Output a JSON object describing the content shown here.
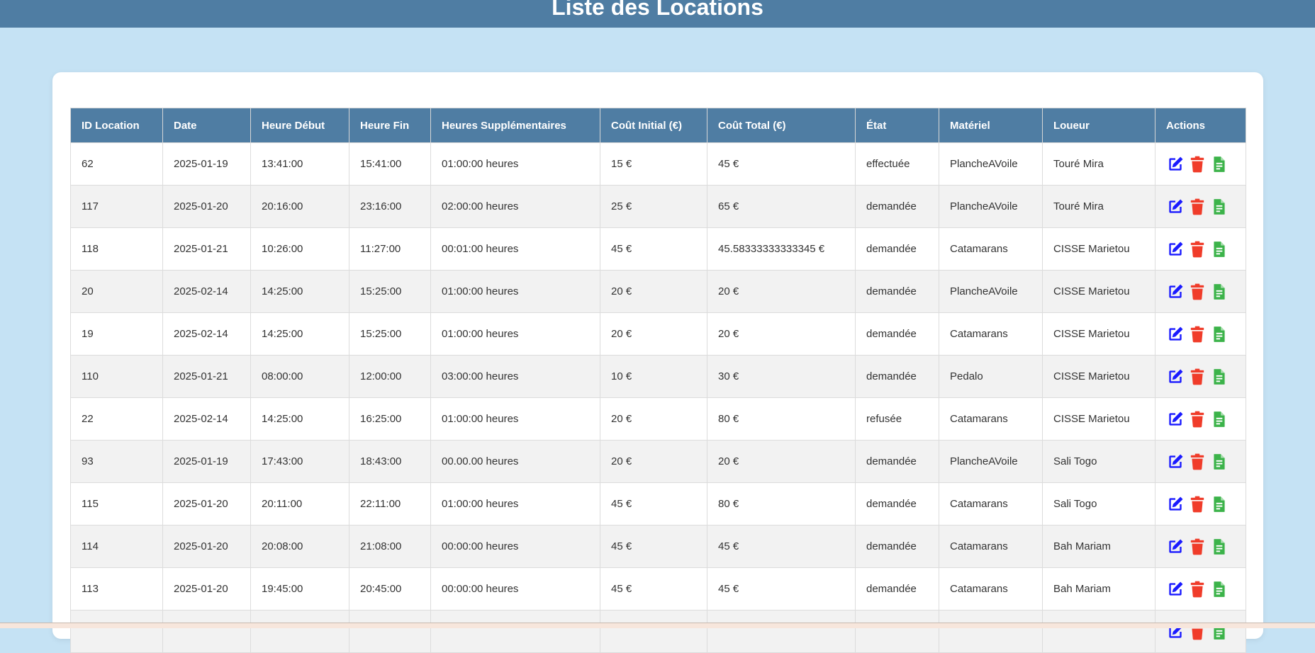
{
  "header": {
    "title": "Liste des Locations"
  },
  "table": {
    "columns": [
      "ID Location",
      "Date",
      "Heure Début",
      "Heure Fin",
      "Heures Supplémentaires",
      "Coût Initial (€)",
      "Coût Total (€)",
      "État",
      "Matériel",
      "Loueur",
      "Actions"
    ],
    "rows": [
      [
        "62",
        "2025-01-19",
        "13:41:00",
        "15:41:00",
        "01:00:00 heures",
        "15 €",
        "45 €",
        "effectuée",
        "PlancheAVoile",
        "Touré Mira"
      ],
      [
        "117",
        "2025-01-20",
        "20:16:00",
        "23:16:00",
        "02:00:00 heures",
        "25 €",
        "65 €",
        "demandée",
        "PlancheAVoile",
        "Touré Mira"
      ],
      [
        "118",
        "2025-01-21",
        "10:26:00",
        "11:27:00",
        "00:01:00 heures",
        "45 €",
        "45.58333333333345 €",
        "demandée",
        "Catamarans",
        "CISSE Marietou"
      ],
      [
        "20",
        "2025-02-14",
        "14:25:00",
        "15:25:00",
        "01:00:00 heures",
        "20 €",
        "20 €",
        "demandée",
        "PlancheAVoile",
        "CISSE Marietou"
      ],
      [
        "19",
        "2025-02-14",
        "14:25:00",
        "15:25:00",
        "01:00:00 heures",
        "20 €",
        "20 €",
        "demandée",
        "Catamarans",
        "CISSE Marietou"
      ],
      [
        "110",
        "2025-01-21",
        "08:00:00",
        "12:00:00",
        "03:00:00 heures",
        "10 €",
        "30 €",
        "demandée",
        "Pedalo",
        "CISSE Marietou"
      ],
      [
        "22",
        "2025-02-14",
        "14:25:00",
        "16:25:00",
        "01:00:00 heures",
        "20 €",
        "80 €",
        "refusée",
        "Catamarans",
        "CISSE Marietou"
      ],
      [
        "93",
        "2025-01-19",
        "17:43:00",
        "18:43:00",
        "00.00.00 heures",
        "20 €",
        "20 €",
        "demandée",
        "PlancheAVoile",
        "Sali Togo"
      ],
      [
        "115",
        "2025-01-20",
        "20:11:00",
        "22:11:00",
        "01:00:00 heures",
        "45 €",
        "80 €",
        "demandée",
        "Catamarans",
        "Sali Togo"
      ],
      [
        "114",
        "2025-01-20",
        "20:08:00",
        "21:08:00",
        "00:00:00 heures",
        "45 €",
        "45 €",
        "demandée",
        "Catamarans",
        "Bah Mariam"
      ],
      [
        "113",
        "2025-01-20",
        "19:45:00",
        "20:45:00",
        "00:00:00 heures",
        "45 €",
        "45 €",
        "demandée",
        "Catamarans",
        "Bah Mariam"
      ],
      [
        "",
        "",
        "",
        "",
        "",
        "",
        "",
        "",
        "",
        ""
      ]
    ],
    "action_icons": {
      "edit": "edit-icon",
      "delete": "trash-icon",
      "document": "document-icon"
    }
  },
  "colors": {
    "background": "#c5e2f4",
    "header": "#4f7da3",
    "edit": "#1a1aff",
    "delete": "#f03c2a",
    "document": "#3cb34a"
  }
}
